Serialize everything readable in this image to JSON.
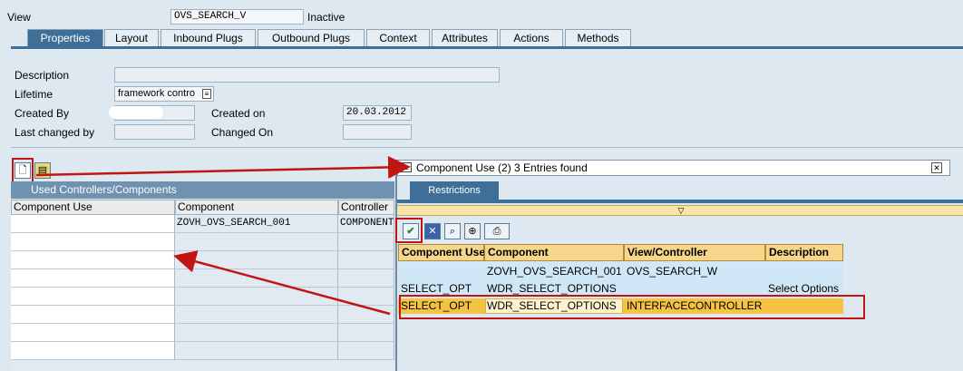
{
  "header": {
    "view_label": "View",
    "view_value": "OVS_SEARCH_V",
    "status": "Inactive"
  },
  "tabs": [
    "Properties",
    "Layout",
    "Inbound Plugs",
    "Outbound Plugs",
    "Context",
    "Attributes",
    "Actions",
    "Methods"
  ],
  "form": {
    "description_label": "Description",
    "description_value": "",
    "lifetime_label": "Lifetime",
    "lifetime_value": "framework contro",
    "created_by_label": "Created By",
    "created_by_value": "",
    "created_on_label": "Created on",
    "created_on_value": "20.03.2012",
    "last_changed_label": "Last changed by",
    "last_changed_value": "",
    "changed_on_label": "Changed On",
    "changed_on_value": ""
  },
  "left_table": {
    "title": "Used Controllers/Components",
    "columns": [
      "Component Use",
      "Component",
      "Controller"
    ],
    "rows": [
      [
        "",
        "ZOVH_OVS_SEARCH_001",
        "COMPONENT"
      ]
    ]
  },
  "popup": {
    "title": "Component Use (2)   3 Entries found",
    "tab": "Restrictions",
    "columns": [
      "Component Use",
      "Component",
      "View/Controller",
      "Description"
    ],
    "rows": [
      [
        "",
        "ZOVH_OVS_SEARCH_001",
        "OVS_SEARCH_W",
        ""
      ],
      [
        "SELECT_OPT",
        "WDR_SELECT_OPTIONS",
        "",
        "Select Options"
      ],
      [
        "SELECT_OPT",
        "WDR_SELECT_OPTIONS",
        "INTERFACECONTROLLER",
        ""
      ]
    ]
  },
  "colors": {
    "accent": "#3f6f96",
    "selected_row": "#f5c242",
    "highlight": "#c21414"
  }
}
